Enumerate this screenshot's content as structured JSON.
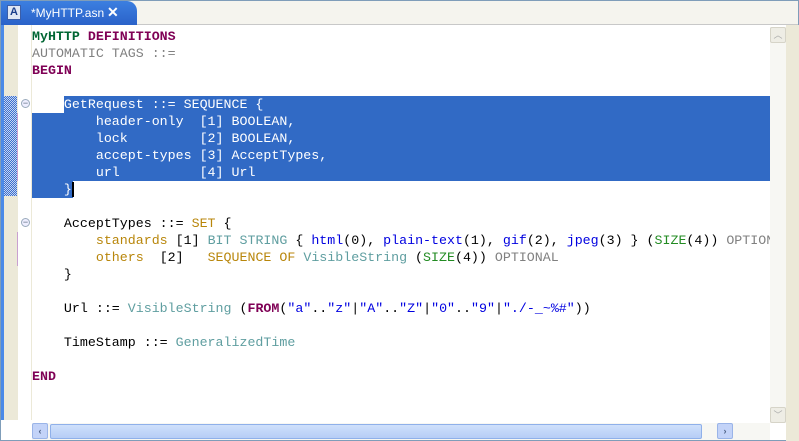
{
  "tab": {
    "title": "*MyHTTP.asn",
    "icon": "asn-file-icon",
    "close": "✕"
  },
  "colors": {
    "selection": "#316AC5",
    "keyword": "#7F0055",
    "type": "#5F9EA0",
    "string": "#0000E0",
    "constraint": "#228B22",
    "component": "#B8860B"
  },
  "lines": [
    [
      {
        "t": "MyHTTP",
        "c": "mod"
      },
      {
        "t": " DEFINITIONS",
        "c": "kw"
      }
    ],
    [
      {
        "t": "AUTOMATIC TAGS ::=",
        "c": "gray"
      }
    ],
    [
      {
        "t": "BEGIN",
        "c": "kw"
      }
    ],
    [],
    [
      {
        "t": "    GetRequest ::= SEQUENCE {",
        "c": "pl"
      }
    ],
    [
      {
        "t": "        header-only  [1] BOOLEAN,",
        "c": "pl"
      }
    ],
    [
      {
        "t": "        lock         [2] BOOLEAN,",
        "c": "pl"
      }
    ],
    [
      {
        "t": "        accept-types [3] AcceptTypes,",
        "c": "pl"
      }
    ],
    [
      {
        "t": "        url          [4] Url",
        "c": "pl"
      }
    ],
    [
      {
        "t": "    }",
        "c": "pl"
      }
    ],
    [],
    [
      {
        "t": "    AcceptTypes ::= ",
        "c": "pl"
      },
      {
        "t": "SET",
        "c": "or"
      },
      {
        "t": " {",
        "c": "pl"
      }
    ],
    [
      {
        "t": "        ",
        "c": "pl"
      },
      {
        "t": "standards",
        "c": "or"
      },
      {
        "t": " [1] ",
        "c": "pl"
      },
      {
        "t": "BIT STRING",
        "c": "teal"
      },
      {
        "t": " { ",
        "c": "pl"
      },
      {
        "t": "html",
        "c": "blue"
      },
      {
        "t": "(0), ",
        "c": "pl"
      },
      {
        "t": "plain-text",
        "c": "blue"
      },
      {
        "t": "(1), ",
        "c": "pl"
      },
      {
        "t": "gif",
        "c": "blue"
      },
      {
        "t": "(2), ",
        "c": "pl"
      },
      {
        "t": "jpeg",
        "c": "blue"
      },
      {
        "t": "(3) } (",
        "c": "pl"
      },
      {
        "t": "SIZE",
        "c": "green"
      },
      {
        "t": "(4)) ",
        "c": "pl"
      },
      {
        "t": "OPTIONAL",
        "c": "gray"
      }
    ],
    [
      {
        "t": "        ",
        "c": "pl"
      },
      {
        "t": "others",
        "c": "or"
      },
      {
        "t": "  [2]   ",
        "c": "pl"
      },
      {
        "t": "SEQUENCE OF",
        "c": "or"
      },
      {
        "t": " ",
        "c": "pl"
      },
      {
        "t": "VisibleString",
        "c": "teal"
      },
      {
        "t": " (",
        "c": "pl"
      },
      {
        "t": "SIZE",
        "c": "green"
      },
      {
        "t": "(4)) ",
        "c": "pl"
      },
      {
        "t": "OPTIONAL",
        "c": "gray"
      }
    ],
    [
      {
        "t": "    }",
        "c": "pl"
      }
    ],
    [],
    [
      {
        "t": "    Url ::= ",
        "c": "pl"
      },
      {
        "t": "VisibleString",
        "c": "teal"
      },
      {
        "t": " (",
        "c": "pl"
      },
      {
        "t": "FROM",
        "c": "kw"
      },
      {
        "t": "(",
        "c": "pl"
      },
      {
        "t": "\"a\"",
        "c": "blue"
      },
      {
        "t": "..",
        "c": "pl"
      },
      {
        "t": "\"z\"",
        "c": "blue"
      },
      {
        "t": "|",
        "c": "pl"
      },
      {
        "t": "\"A\"",
        "c": "blue"
      },
      {
        "t": "..",
        "c": "pl"
      },
      {
        "t": "\"Z\"",
        "c": "blue"
      },
      {
        "t": "|",
        "c": "pl"
      },
      {
        "t": "\"0\"",
        "c": "blue"
      },
      {
        "t": "..",
        "c": "pl"
      },
      {
        "t": "\"9\"",
        "c": "blue"
      },
      {
        "t": "|",
        "c": "pl"
      },
      {
        "t": "\"./-_~%#\"",
        "c": "blue"
      },
      {
        "t": "))",
        "c": "pl"
      }
    ],
    [],
    [
      {
        "t": "    TimeStamp ::= ",
        "c": "pl"
      },
      {
        "t": "GeneralizedTime",
        "c": "teal"
      }
    ],
    [],
    [
      {
        "t": "END",
        "c": "kw"
      }
    ]
  ]
}
